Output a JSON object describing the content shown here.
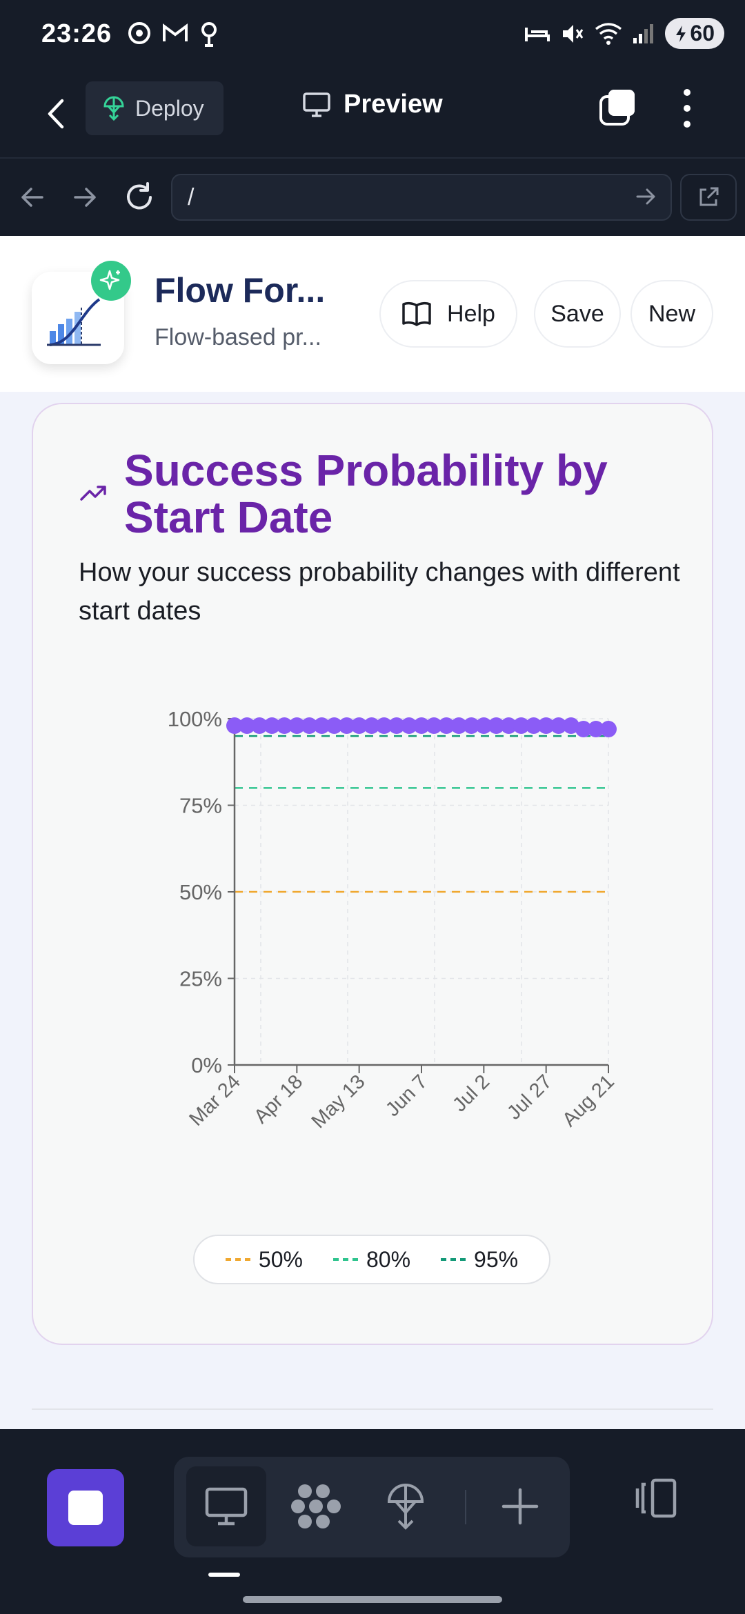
{
  "status_bar": {
    "time": "23:26",
    "battery": "60"
  },
  "top_bar": {
    "deploy_label": "Deploy",
    "preview_label": "Preview"
  },
  "url_bar": {
    "url": "/"
  },
  "app_header": {
    "title": "Flow For...",
    "subtitle": "Flow-based pr...",
    "help_label": "Help",
    "save_label": "Save",
    "new_label": "New"
  },
  "card": {
    "title": "Success Probability by Start Date",
    "subtitle": "How your success probability changes with different start dates"
  },
  "chart_data": {
    "type": "line",
    "title": "Success Probability by Start Date",
    "xlabel": "",
    "ylabel": "",
    "x_tick_labels": [
      "Mar 24",
      "Apr 18",
      "May 13",
      "Jun 7",
      "Jul 2",
      "Jul 27",
      "Aug 21"
    ],
    "y_tick_labels": [
      "0%",
      "25%",
      "50%",
      "75%",
      "100%"
    ],
    "ylim": [
      0,
      100
    ],
    "grid": true,
    "x": [
      "Mar 24",
      "Mar 29",
      "Apr 3",
      "Apr 8",
      "Apr 13",
      "Apr 18",
      "Apr 23",
      "Apr 28",
      "May 3",
      "May 8",
      "May 13",
      "May 18",
      "May 23",
      "May 28",
      "Jun 2",
      "Jun 7",
      "Jun 12",
      "Jun 17",
      "Jun 22",
      "Jun 27",
      "Jul 2",
      "Jul 7",
      "Jul 12",
      "Jul 17",
      "Jul 22",
      "Jul 27",
      "Aug 1",
      "Aug 6",
      "Aug 11",
      "Aug 16",
      "Aug 21"
    ],
    "series": [
      {
        "values": [
          98,
          98,
          98,
          98,
          98,
          98,
          98,
          98,
          98,
          98,
          98,
          98,
          98,
          98,
          98,
          98,
          98,
          98,
          98,
          98,
          98,
          98,
          98,
          98,
          98,
          98,
          98,
          98,
          97,
          97,
          97
        ],
        "color": "#8b5cf6"
      }
    ],
    "thresholds": [
      {
        "name": "50%",
        "value": 50,
        "color": "#f0a830"
      },
      {
        "name": "80%",
        "value": 80,
        "color": "#2fc48e"
      },
      {
        "name": "95%",
        "value": 95,
        "color": "#149a78"
      }
    ],
    "legend_position": "bottom"
  }
}
